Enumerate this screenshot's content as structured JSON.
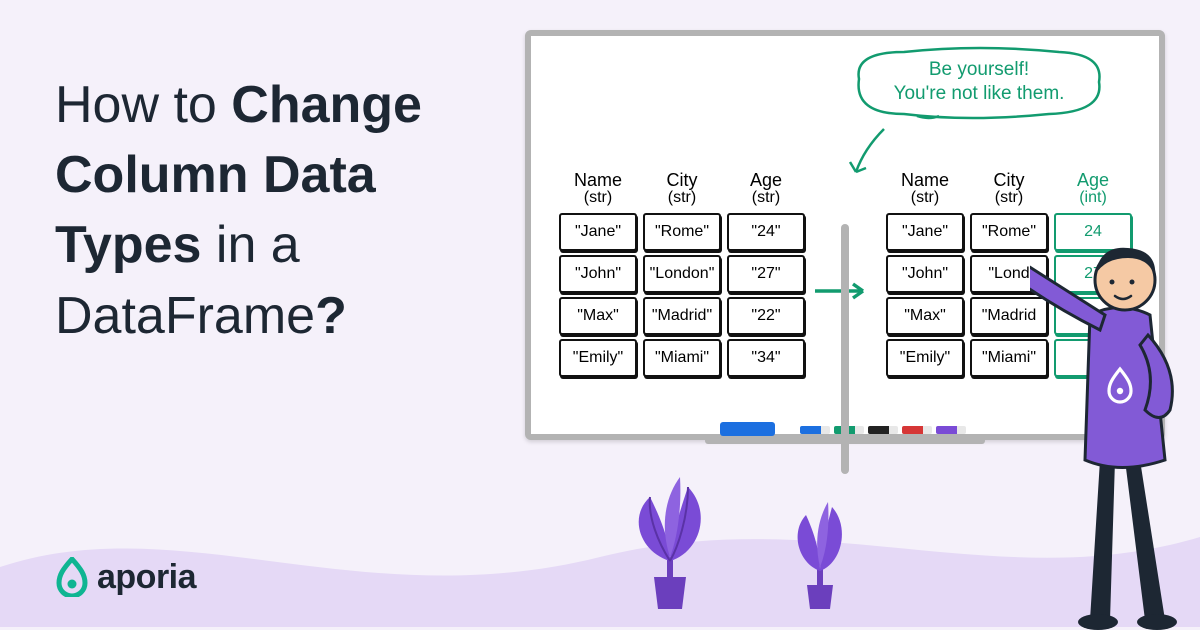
{
  "title": {
    "pre1": "How to ",
    "bold": "Change Column Data Types",
    "post1": " in a DataFrame",
    "q": "?"
  },
  "logo": {
    "brand": "aporia"
  },
  "whiteboard": {
    "speech_line1": "Be yourself!",
    "speech_line2": "You're not like them.",
    "columns_left": {
      "name": {
        "label": "Name",
        "type": "(str)"
      },
      "city": {
        "label": "City",
        "type": "(str)"
      },
      "age": {
        "label": "Age",
        "type": "(str)"
      }
    },
    "columns_right": {
      "name": {
        "label": "Name",
        "type": "(str)"
      },
      "city": {
        "label": "City",
        "type": "(str)"
      },
      "age": {
        "label": "Age",
        "type": "(int)"
      }
    },
    "rows_left": {
      "r0": {
        "name": "\"Jane\"",
        "city": "\"Rome\"",
        "age": "\"24\""
      },
      "r1": {
        "name": "\"John\"",
        "city": "\"London\"",
        "age": "\"27\""
      },
      "r2": {
        "name": "\"Max\"",
        "city": "\"Madrid\"",
        "age": "\"22\""
      },
      "r3": {
        "name": "\"Emily\"",
        "city": "\"Miami\"",
        "age": "\"34\""
      }
    },
    "rows_right": {
      "r0": {
        "name": "\"Jane\"",
        "city": "\"Rome\"",
        "age": "24"
      },
      "r1": {
        "name": "\"John\"",
        "city": "\"Lond",
        "age": "27"
      },
      "r2": {
        "name": "\"Max\"",
        "city": "\"Madrid",
        "age": ""
      },
      "r3": {
        "name": "\"Emily\"",
        "city": "\"Miami\"",
        "age": ""
      }
    }
  }
}
